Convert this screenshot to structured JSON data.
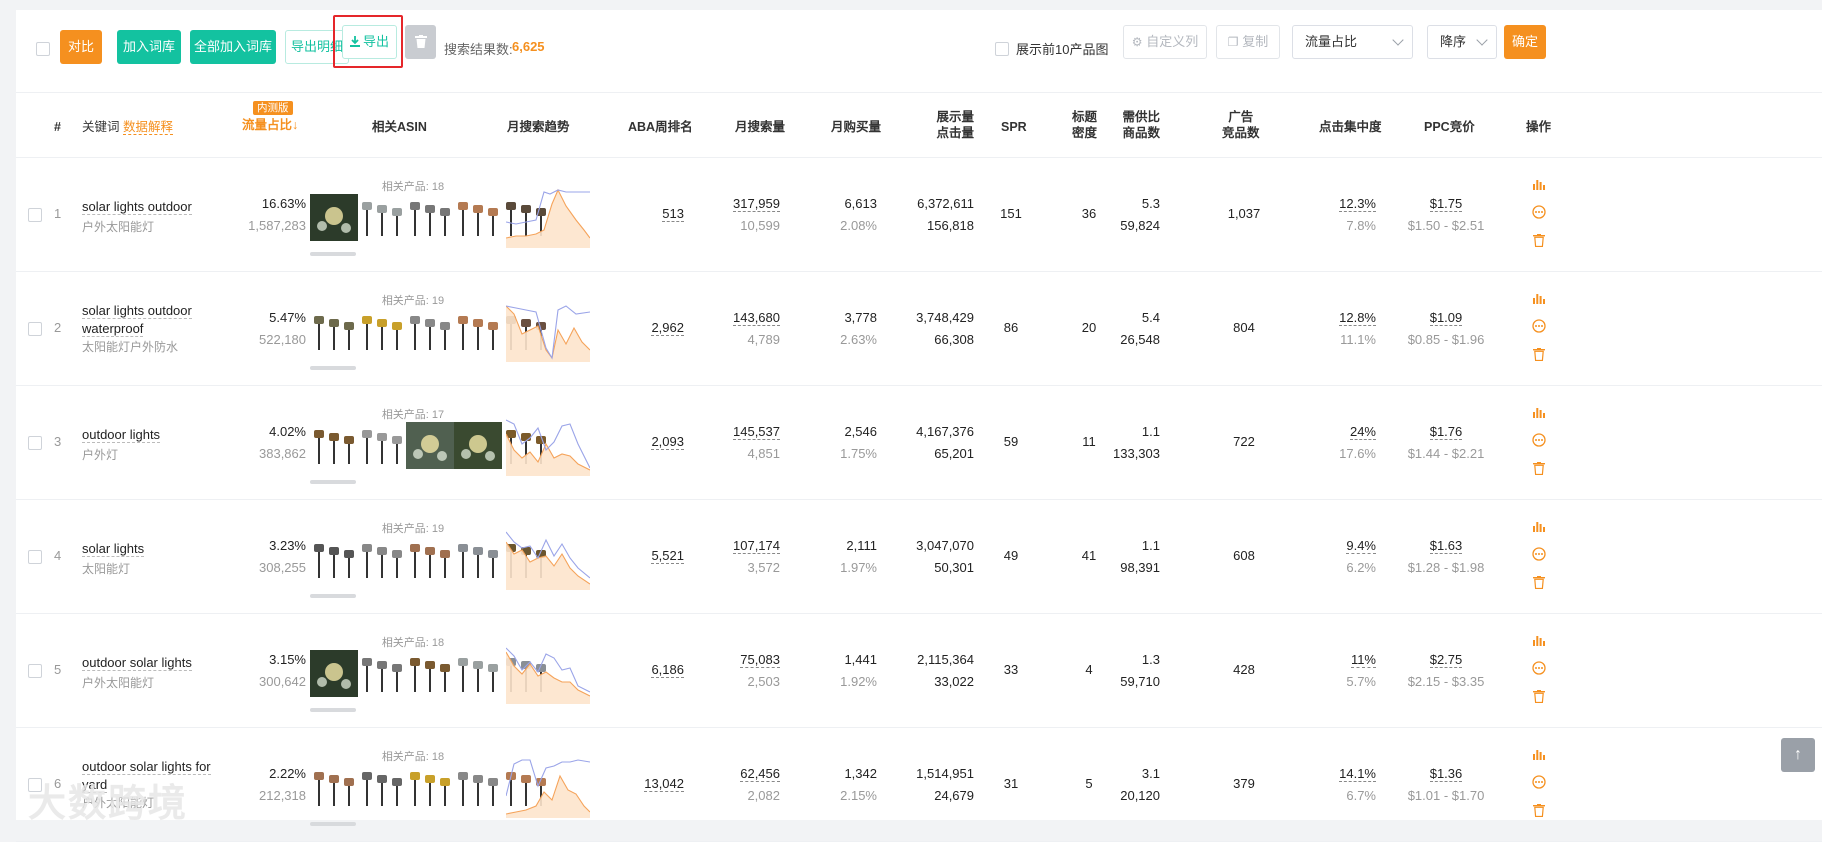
{
  "toolbar": {
    "compare_label": "对比",
    "add_lexicon_label": "加入词库",
    "add_all_lexicon_label": "全部加入词库",
    "export_detail_label": "导出明细",
    "export_label": "导出",
    "result_count_label": "搜索结果数:",
    "result_count_value": "6,625",
    "show_top10_label": "展示前10产品图",
    "custom_columns_label": "自定义列",
    "copy_label": "复制",
    "sort_field_value": "流量占比",
    "sort_order_value": "降序",
    "confirm_label": "确定"
  },
  "colors": {
    "accent_orange": "#f5901f",
    "accent_green": "#13c2a0",
    "highlight_red": "#e5262a",
    "trend_blue": "#9aa4e8",
    "trend_orange": "#f5a35a"
  },
  "table": {
    "headers": {
      "index": "#",
      "keyword": "关键词",
      "keyword_link": "数据解释",
      "traffic_badge": "内测版",
      "traffic_share": "流量占比",
      "traffic_sort_arrow": "↓",
      "related_asin": "相关ASIN",
      "monthly_trend": "月搜索趋势",
      "aba_rank": "ABA周排名",
      "monthly_search": "月搜索量",
      "monthly_purchase": "月购买量",
      "impressions_l1": "展示量",
      "impressions_l2": "点击量",
      "spr": "SPR",
      "title_density_l1": "标题",
      "title_density_l2": "密度",
      "supply_ratio_l1": "需供比",
      "supply_ratio_l2": "商品数",
      "ad_products_l1": "广告",
      "ad_products_l2": "竞品数",
      "click_concentration": "点击集中度",
      "ppc_bid": "PPC竞价",
      "actions": "操作"
    },
    "rows": [
      {
        "index": "1",
        "keyword": "solar lights outdoor",
        "keyword_cn": "户外太阳能灯",
        "share": "16.63%",
        "share_sub": "1,587,283",
        "related": "相关产品: 18",
        "aba": "513",
        "search": "317,959",
        "search_sub": "10,599",
        "purchase": "6,613",
        "purchase_sub": "2.08%",
        "impressions": "6,372,611",
        "clicks": "156,818",
        "spr": "151",
        "density": "36",
        "ratio": "5.3",
        "products": "59,824",
        "ads": "1,037",
        "click_conc": "12.3%",
        "click_conc_sub": "7.8%",
        "ppc": "$1.75",
        "ppc_range": "$1.50 - $2.51"
      },
      {
        "index": "2",
        "keyword": "solar lights outdoor waterproof",
        "keyword_cn": "太阳能灯户外防水",
        "share": "5.47%",
        "share_sub": "522,180",
        "related": "相关产品: 19",
        "aba": "2,962",
        "search": "143,680",
        "search_sub": "4,789",
        "purchase": "3,778",
        "purchase_sub": "2.63%",
        "impressions": "3,748,429",
        "clicks": "66,308",
        "spr": "86",
        "density": "20",
        "ratio": "5.4",
        "products": "26,548",
        "ads": "804",
        "click_conc": "12.8%",
        "click_conc_sub": "11.1%",
        "ppc": "$1.09",
        "ppc_range": "$0.85 - $1.96"
      },
      {
        "index": "3",
        "keyword": "outdoor lights",
        "keyword_cn": "户外灯",
        "share": "4.02%",
        "share_sub": "383,862",
        "related": "相关产品: 17",
        "aba": "2,093",
        "search": "145,537",
        "search_sub": "4,851",
        "purchase": "2,546",
        "purchase_sub": "1.75%",
        "impressions": "4,167,376",
        "clicks": "65,201",
        "spr": "59",
        "density": "11",
        "ratio": "1.1",
        "products": "133,303",
        "ads": "722",
        "click_conc": "24%",
        "click_conc_sub": "17.6%",
        "ppc": "$1.76",
        "ppc_range": "$1.44 - $2.21"
      },
      {
        "index": "4",
        "keyword": "solar lights",
        "keyword_cn": "太阳能灯",
        "share": "3.23%",
        "share_sub": "308,255",
        "related": "相关产品: 19",
        "aba": "5,521",
        "search": "107,174",
        "search_sub": "3,572",
        "purchase": "2,111",
        "purchase_sub": "1.97%",
        "impressions": "3,047,070",
        "clicks": "50,301",
        "spr": "49",
        "density": "41",
        "ratio": "1.1",
        "products": "98,391",
        "ads": "608",
        "click_conc": "9.4%",
        "click_conc_sub": "6.2%",
        "ppc": "$1.63",
        "ppc_range": "$1.28 - $1.98"
      },
      {
        "index": "5",
        "keyword": "outdoor solar lights",
        "keyword_cn": "户外太阳能灯",
        "share": "3.15%",
        "share_sub": "300,642",
        "related": "相关产品: 18",
        "aba": "6,186",
        "search": "75,083",
        "search_sub": "2,503",
        "purchase": "1,441",
        "purchase_sub": "1.92%",
        "impressions": "2,115,364",
        "clicks": "33,022",
        "spr": "33",
        "density": "4",
        "ratio": "1.3",
        "products": "59,710",
        "ads": "428",
        "click_conc": "11%",
        "click_conc_sub": "5.7%",
        "ppc": "$2.75",
        "ppc_range": "$2.15 - $3.35"
      },
      {
        "index": "6",
        "keyword": "outdoor solar lights for yard",
        "keyword_cn": "户外太阳能灯",
        "share": "2.22%",
        "share_sub": "212,318",
        "related": "相关产品: 18",
        "aba": "13,042",
        "search": "62,456",
        "search_sub": "2,082",
        "purchase": "1,342",
        "purchase_sub": "2.15%",
        "impressions": "1,514,951",
        "clicks": "24,679",
        "spr": "31",
        "density": "5",
        "ratio": "3.1",
        "products": "20,120",
        "ads": "379",
        "click_conc": "14.1%",
        "click_conc_sub": "6.7%",
        "ppc": "$1.36",
        "ppc_range": "$1.01 - $1.70"
      }
    ]
  },
  "watermark": "大数跨境"
}
